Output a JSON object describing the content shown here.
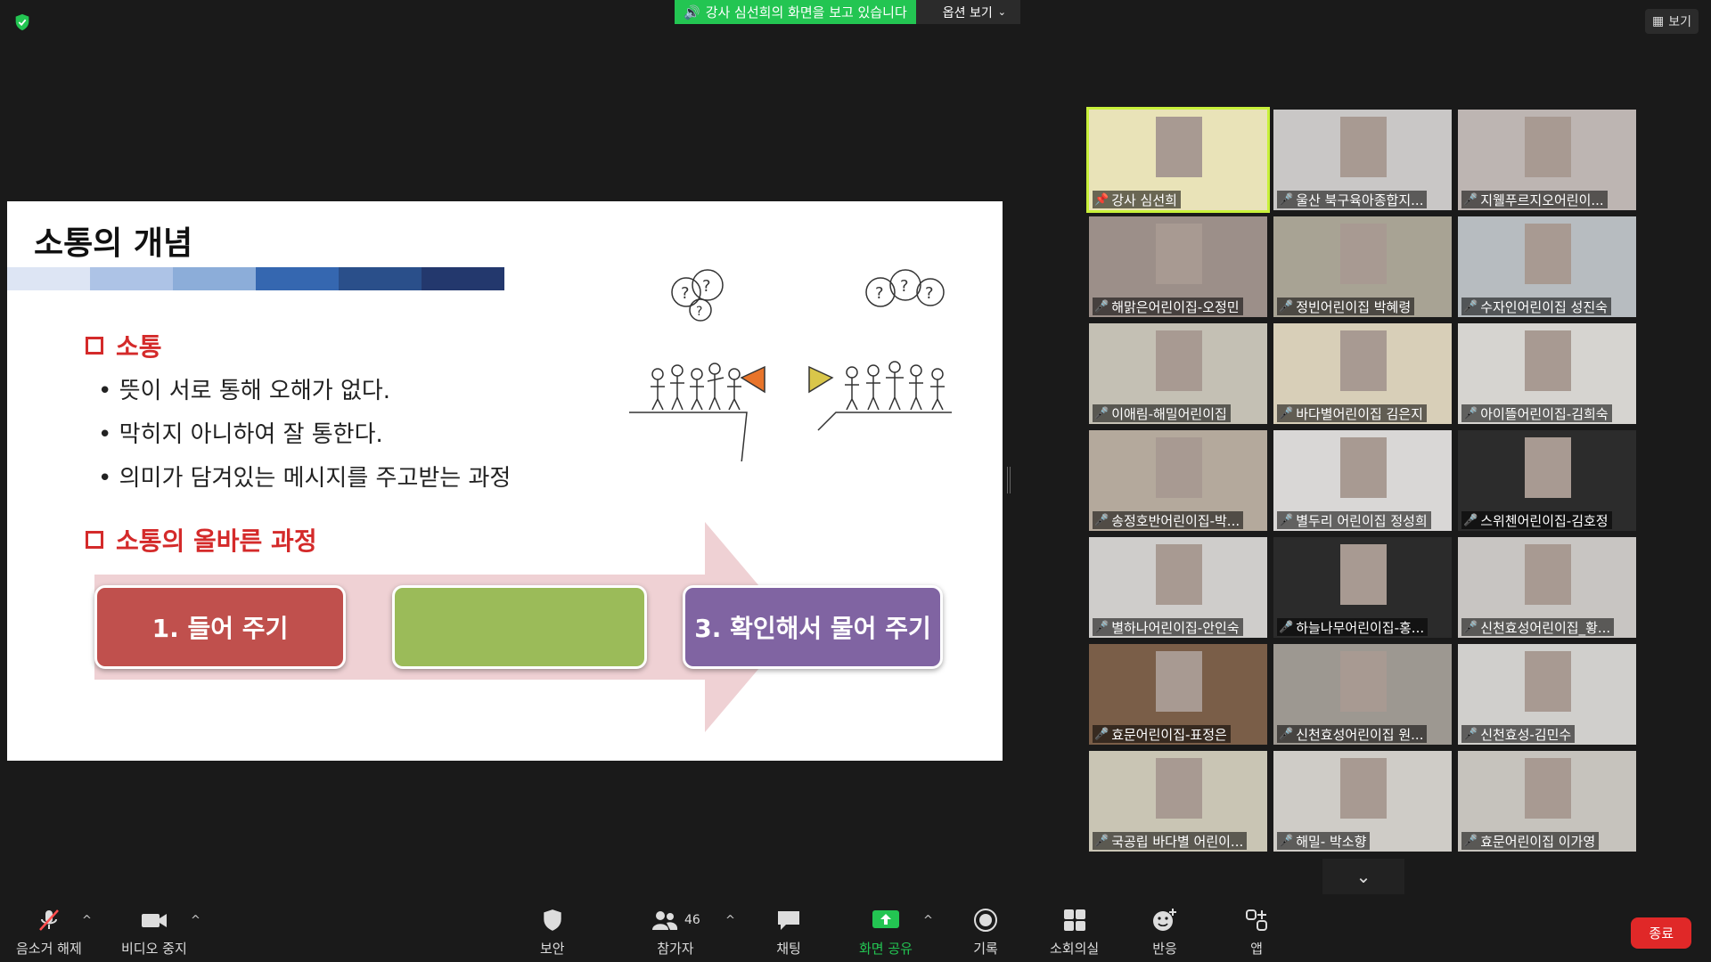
{
  "top": {
    "share_banner": "강사 심선희의 화면을 보고 있습니다",
    "view_options": "옵션 보기",
    "view_button": "보기"
  },
  "slide": {
    "title": "소통의 개념",
    "section1": "소통",
    "bullets": [
      "뜻이 서로 통해 오해가 없다.",
      "막히지 아니하여 잘 통한다.",
      "의미가 담겨있는 메시지를 주고받는 과정"
    ],
    "section2": "소통의 올바른 과정",
    "steps": [
      "1. 들어 주기",
      "",
      "3. 확인해서 물어 주기"
    ],
    "colors": {
      "title_bar": [
        "#dde5f4",
        "#adc3e6",
        "#8cadd9",
        "#3567b0",
        "#2a4f8a",
        "#23386d"
      ],
      "section": "#d42a2a",
      "arrow": "#efd1d4",
      "step1": "#c0504d",
      "step2": "#9bbb59",
      "step3": "#8064a2"
    }
  },
  "participants": [
    {
      "name": "강사 심선희",
      "pinned": true
    },
    {
      "name": "울산 북구육아종합지..."
    },
    {
      "name": "지웰푸르지오어린이..."
    },
    {
      "name": "해맑은어린이집-오정민"
    },
    {
      "name": "정빈어린이집 박혜령"
    },
    {
      "name": "수자인어린이집 성진숙"
    },
    {
      "name": "이애림-해밀어린이집"
    },
    {
      "name": "바다별어린이집 김은지"
    },
    {
      "name": "아이뜰어린이집-김희숙"
    },
    {
      "name": "송정호반어린이집-박..."
    },
    {
      "name": "별두리 어린이집 정성희"
    },
    {
      "name": "스위첸어린이집-김호정"
    },
    {
      "name": "별하나어린이집-안인숙"
    },
    {
      "name": "하늘나무어린이집-홍..."
    },
    {
      "name": "신천효성어린이집_황..."
    },
    {
      "name": "효문어린이집-표정은"
    },
    {
      "name": "신천효성어린이집 원..."
    },
    {
      "name": "신천효성-김민수"
    },
    {
      "name": "국공립 바다별 어린이..."
    },
    {
      "name": "해밀- 박소향"
    },
    {
      "name": "효문어린이집 이가영"
    }
  ],
  "toolbar": {
    "mute": "음소거 해제",
    "video": "비디오 중지",
    "security": "보안",
    "participants": "참가자",
    "participant_count": "46",
    "chat": "채팅",
    "share": "화면 공유",
    "record": "기록",
    "breakout": "소회의실",
    "reactions": "반응",
    "apps": "앱",
    "end": "종료"
  }
}
